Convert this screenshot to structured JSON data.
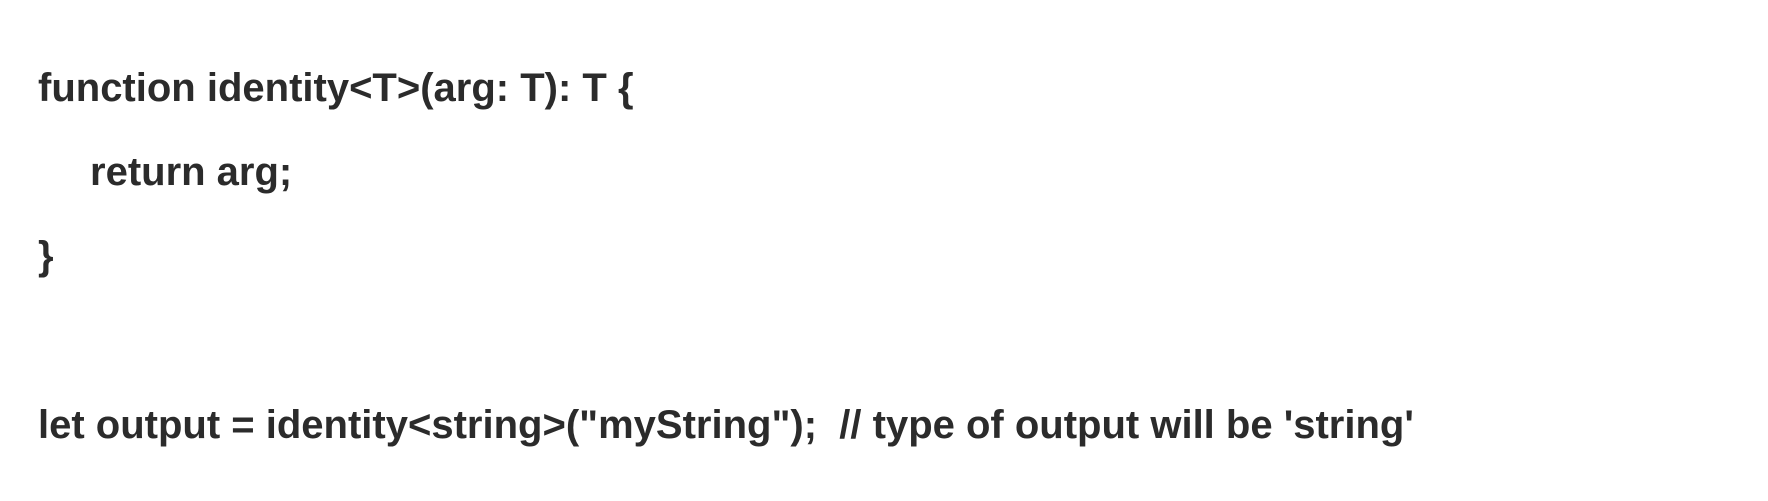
{
  "code": {
    "lines": [
      "function identity<T>(arg: T): T {",
      "return arg;",
      "}",
      "",
      "let output = identity<string>(\"myString\");  // type of output will be 'string'"
    ]
  }
}
